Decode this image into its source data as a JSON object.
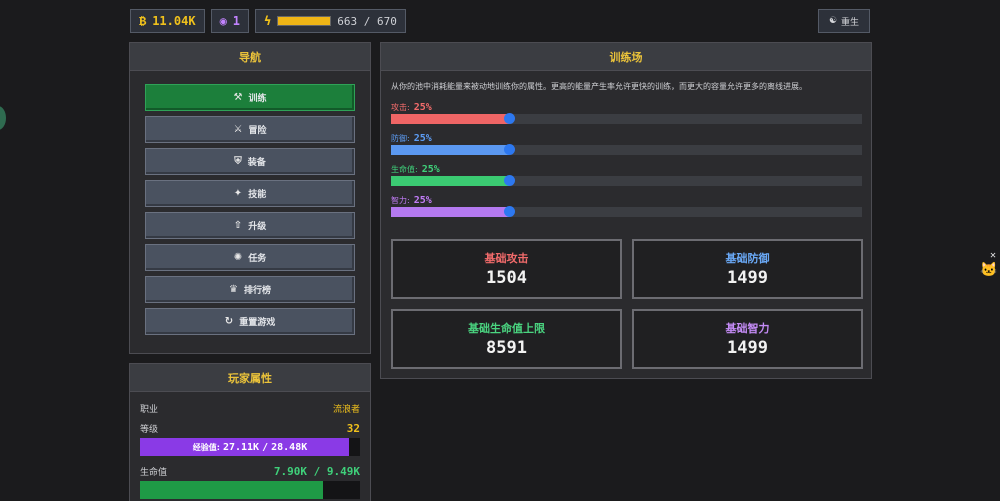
{
  "topbar": {
    "gold": "11.04K",
    "gems": "1",
    "energy_current": "663",
    "energy_sep": "/",
    "energy_max": "670",
    "energy_fraction": 0.989,
    "rebirth_label": "重生"
  },
  "nav": {
    "title": "导航",
    "items": [
      {
        "label": "训练",
        "icon": "dumbbell-icon",
        "glyph": "⚒"
      },
      {
        "label": "冒险",
        "icon": "crossed-swords-icon",
        "glyph": "⚔"
      },
      {
        "label": "装备",
        "icon": "armor-icon",
        "glyph": "⛨"
      },
      {
        "label": "技能",
        "icon": "skill-icon",
        "glyph": "✦"
      },
      {
        "label": "升级",
        "icon": "upgrade-icon",
        "glyph": "⇧"
      },
      {
        "label": "任务",
        "icon": "quest-icon",
        "glyph": "✺"
      },
      {
        "label": "排行榜",
        "icon": "trophy-icon",
        "glyph": "♛"
      },
      {
        "label": "重置游戏",
        "icon": "reset-icon",
        "glyph": "↻"
      }
    ]
  },
  "player": {
    "title": "玩家属性",
    "class_label": "职业",
    "class_value": "流浪者",
    "level_label": "等级",
    "level_value": "32",
    "exp_label": "经验值:",
    "exp_current": "27.11K",
    "exp_sep": "/",
    "exp_max": "28.48K",
    "exp_fraction": 0.952,
    "hp_label": "生命值",
    "hp_current": "7.90K",
    "hp_sep": "/",
    "hp_max": "9.49K",
    "hp_fraction": 0.832
  },
  "training": {
    "title": "训练场",
    "description": "从你的池中消耗能量来被动地训练你的属性。更高的能量产生率允许更快的训练，而更大的容量允许更多的离线进展。",
    "sliders": [
      {
        "label": "攻击:",
        "pct": "25%",
        "value": 25,
        "color": "#f26b6b",
        "fill": "#ef6565"
      },
      {
        "label": "防御:",
        "pct": "25%",
        "value": 25,
        "color": "#5d9df5",
        "fill": "#5b98f0"
      },
      {
        "label": "生命值:",
        "pct": "25%",
        "value": 25,
        "color": "#3fd07a",
        "fill": "#3bca72"
      },
      {
        "label": "智力:",
        "pct": "25%",
        "value": 25,
        "color": "#c17cf7",
        "fill": "#b479f0"
      }
    ],
    "stats": [
      {
        "name": "基础攻击",
        "value": "1504",
        "color": "#f26b6b"
      },
      {
        "name": "基础防御",
        "value": "1499",
        "color": "#6aa9f7"
      },
      {
        "name": "基础生命值上限",
        "value": "8591",
        "color": "#4ad480"
      },
      {
        "name": "基础智力",
        "value": "1499",
        "color": "#c58cf7"
      }
    ]
  }
}
